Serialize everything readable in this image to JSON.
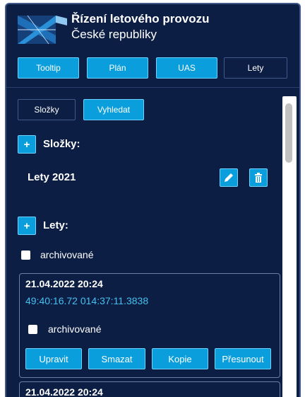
{
  "header": {
    "org_line1": "Řízení letového provozu",
    "org_line2": "České republiky"
  },
  "top_tabs": [
    {
      "label": "Tooltip"
    },
    {
      "label": "Plán"
    },
    {
      "label": "UAS"
    },
    {
      "label": "Lety"
    }
  ],
  "sub_tabs": [
    {
      "label": "Složky"
    },
    {
      "label": "Vyhledat"
    }
  ],
  "folders_section": {
    "add_label": "+",
    "heading": "Složky:",
    "items": [
      {
        "name": "Lety 2021"
      }
    ]
  },
  "flights_section": {
    "add_label": "+",
    "heading": "Lety:",
    "archived_label": "archivované",
    "flights": [
      {
        "datetime": "21.04.2022 20:24",
        "coords": "49:40:16.72 014:37:11.3838",
        "archived_label": "archivované",
        "actions": [
          "Upravit",
          "Smazat",
          "Kopie",
          "Přesunout"
        ]
      },
      {
        "datetime": "21.04.2022 20:24"
      }
    ]
  },
  "colors": {
    "panel_bg": "#0c1e44",
    "accent": "#0a9fdc",
    "coords": "#46c0f0"
  }
}
